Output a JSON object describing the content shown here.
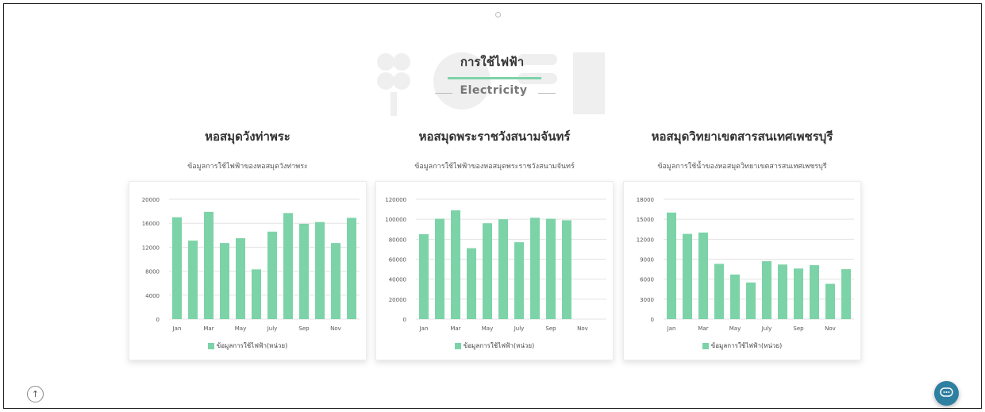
{
  "header": {
    "title": "การใช้ไฟฟ้า",
    "subtitle": "Electricity"
  },
  "sections": [
    {
      "title": "หอสมุดวังท่าพระ",
      "description": "ข้อมูลการใช้ไฟฟ้าของหอสมุดวังท่าพระ"
    },
    {
      "title": "หอสมุดพระราชวังสนามจันทร์",
      "description": "ข้อมูลการใช้ไฟฟ้าของหอสมุดพระราชวังสนามจันทร์"
    },
    {
      "title": "หอสมุดวิทยาเขตสารสนเทศเพชรบุรี",
      "description": "ข้อมูลการใช้น้ำของหอสมุดวิทยาเขตสารสนเทศเพชรบุรี"
    }
  ],
  "chart_data": [
    {
      "type": "bar",
      "categories": [
        "Jan",
        "Feb",
        "Mar",
        "Apr",
        "May",
        "Jun",
        "July",
        "Aug",
        "Sep",
        "Oct",
        "Nov",
        "Dec"
      ],
      "tick_labels": [
        "Jan",
        "Mar",
        "May",
        "July",
        "Sep",
        "Nov"
      ],
      "series": [
        {
          "name": "ข้อมูลการใช้ไฟฟ้า(หน่วย)",
          "values": [
            17000,
            13100,
            17900,
            12700,
            13500,
            8300,
            14600,
            17700,
            15900,
            16200,
            12700,
            16900
          ]
        }
      ],
      "ylim": [
        0,
        20000
      ],
      "yticks": [
        0,
        4000,
        8000,
        12000,
        16000,
        20000
      ],
      "color": "#7dd3a8",
      "grid": true,
      "legend": "bottom"
    },
    {
      "type": "bar",
      "categories": [
        "Jan",
        "Feb",
        "Mar",
        "Apr",
        "May",
        "Jun",
        "July",
        "Aug",
        "Sep",
        "Oct",
        "Nov",
        "Dec"
      ],
      "tick_labels": [
        "Jan",
        "Mar",
        "May",
        "July",
        "Sep",
        "Nov"
      ],
      "series": [
        {
          "name": "ข้อมูลการใช้ไฟฟ้า(หน่วย)",
          "values": [
            85000,
            100500,
            109000,
            71000,
            96000,
            100000,
            77000,
            101500,
            100500,
            99000,
            null,
            null
          ]
        }
      ],
      "ylim": [
        0,
        120000
      ],
      "yticks": [
        0,
        20000,
        40000,
        60000,
        80000,
        100000,
        120000
      ],
      "color": "#7dd3a8",
      "grid": true,
      "legend": "bottom"
    },
    {
      "type": "bar",
      "categories": [
        "Jan",
        "Feb",
        "Mar",
        "Apr",
        "May",
        "Jun",
        "July",
        "Aug",
        "Sep",
        "Oct",
        "Nov",
        "Dec"
      ],
      "tick_labels": [
        "Jan",
        "Mar",
        "May",
        "July",
        "Sep",
        "Nov"
      ],
      "series": [
        {
          "name": "ข้อมูลการใช้ไฟฟ้า(หน่วย)",
          "values": [
            16000,
            12800,
            13000,
            8300,
            6700,
            5500,
            8700,
            8200,
            7600,
            8100,
            5300,
            7500
          ]
        }
      ],
      "ylim": [
        0,
        18000
      ],
      "yticks": [
        0,
        3000,
        6000,
        9000,
        12000,
        15000,
        18000
      ],
      "color": "#7dd3a8",
      "grid": true,
      "legend": "bottom"
    }
  ]
}
